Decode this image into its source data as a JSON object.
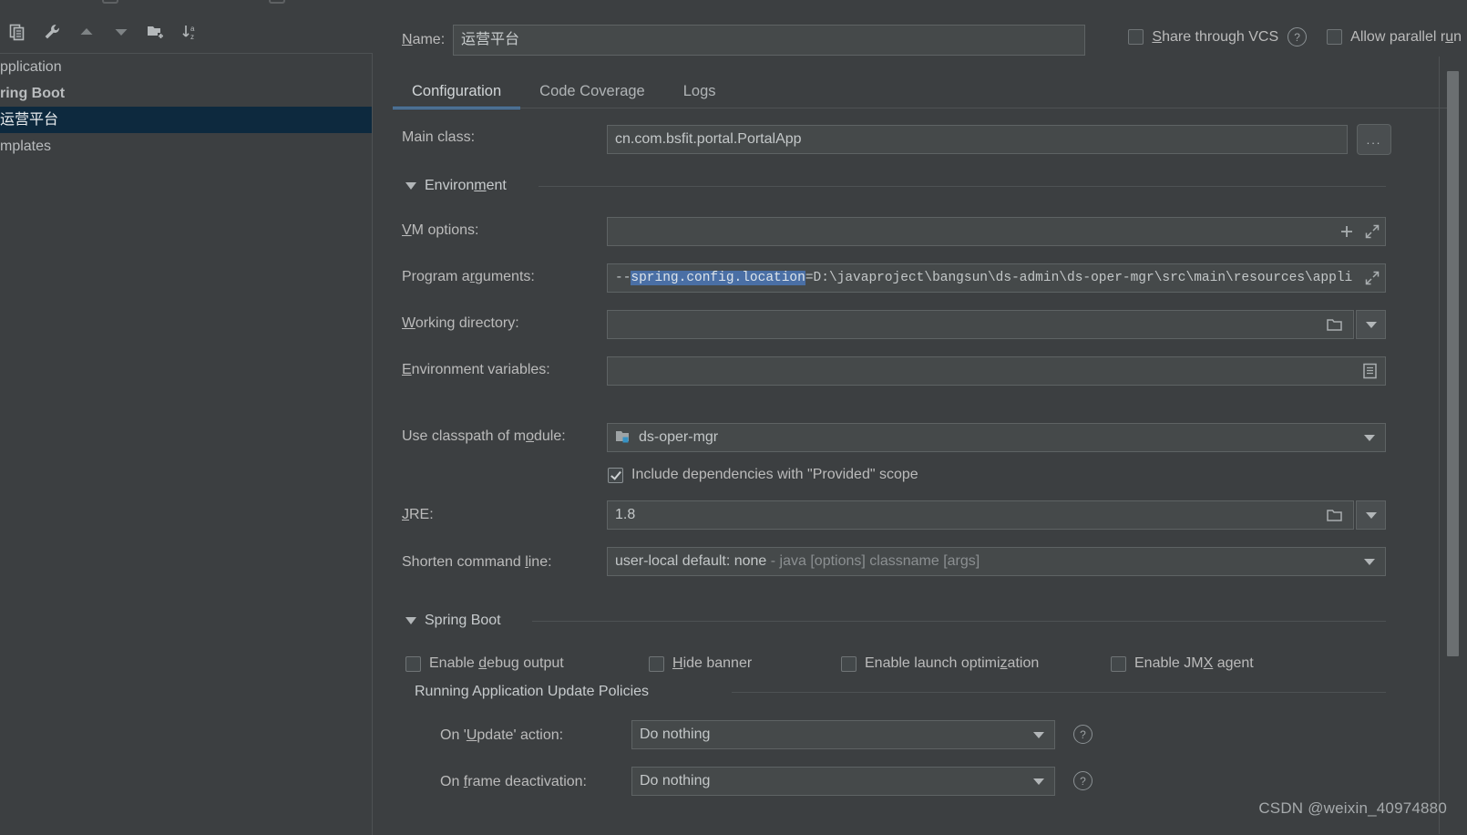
{
  "window": {
    "background_color": "#3c3f41",
    "accent_color": "#4a88c7",
    "selection_color": "#0d293e",
    "text_selection_color": "#4a6fa5"
  },
  "toolbar": {
    "icons": [
      {
        "name": "copy-configuration-icon",
        "title": "Copy Configuration"
      },
      {
        "name": "edit-templates-wrench-icon",
        "title": "Edit Templates"
      },
      {
        "name": "move-up-icon",
        "title": "Move Up"
      },
      {
        "name": "move-down-icon",
        "title": "Move Down"
      },
      {
        "name": "new-folder-icon",
        "title": "Create New Folder"
      },
      {
        "name": "sort-alphabetically-icon",
        "title": "Sort Configurations"
      }
    ]
  },
  "sidebar": {
    "items": [
      {
        "label": "pplication",
        "selected": false
      },
      {
        "label": "ring Boot",
        "selected": false
      },
      {
        "label": "运营平台",
        "selected": true
      },
      {
        "label": "mplates",
        "selected": false
      }
    ]
  },
  "header": {
    "name_label": "Name:",
    "name_label_mnemonic": "N",
    "name_value": "运营平台",
    "share_vcs_label": "Share through VCS",
    "share_vcs_mnemonic": "S",
    "share_vcs_checked": false,
    "help_icon": "help-icon",
    "allow_parallel_label": "Allow parallel run",
    "allow_parallel_mnemonic": "u",
    "allow_parallel_checked": false
  },
  "tabs": [
    {
      "label": "Configuration",
      "active": true
    },
    {
      "label": "Code Coverage",
      "active": false
    },
    {
      "label": "Logs",
      "active": false
    }
  ],
  "form": {
    "main_class": {
      "label": "Main class:",
      "value": "cn.com.bsfit.portal.PortalApp",
      "browse_button": "..."
    },
    "environment_section": {
      "title": "Environment",
      "mnemonic": "m",
      "expanded": true
    },
    "vm_options": {
      "label": "VM options:",
      "mnemonic": "V",
      "value": "",
      "icons": [
        "plus-icon",
        "expand-editor-icon"
      ]
    },
    "program_arguments": {
      "label": "Program arguments:",
      "mnemonic": "r",
      "value_prefix": "--",
      "value_selected": "spring.config.location",
      "value_suffix": "=D:\\javaproject\\bangsun\\ds-admin\\ds-oper-mgr\\src\\main\\resources\\appli",
      "icons": [
        "expand-editor-icon"
      ]
    },
    "working_directory": {
      "label": "Working directory:",
      "mnemonic": "W",
      "value": "",
      "icons": [
        "folder-icon",
        "dropdown-arrow-icon"
      ]
    },
    "environment_variables": {
      "label": "Environment variables:",
      "mnemonic": "E",
      "value": "",
      "icons": [
        "env-list-icon"
      ]
    },
    "classpath_module": {
      "label": "Use classpath of module:",
      "mnemonic": "o",
      "value": "ds-oper-mgr",
      "module_icon": "module-icon"
    },
    "include_provided": {
      "label": "Include dependencies with \"Provided\" scope",
      "checked": true
    },
    "jre": {
      "label": "JRE:",
      "mnemonic": "J",
      "value": "1.8",
      "icons": [
        "folder-icon",
        "dropdown-arrow-icon"
      ]
    },
    "shorten_command_line": {
      "label": "Shorten command line:",
      "mnemonic": "l",
      "value": "user-local default: none",
      "value_hint": "- java [options] classname [args]"
    },
    "spring_boot_section": {
      "title": "Spring Boot",
      "mnemonic": "g",
      "expanded": true
    },
    "spring_boot_checkboxes": [
      {
        "label": "Enable debug output",
        "mnemonic": "d",
        "checked": false
      },
      {
        "label": "Hide banner",
        "mnemonic": "H",
        "checked": false
      },
      {
        "label": "Enable launch optimization",
        "mnemonic": "z",
        "checked": false
      },
      {
        "label": "Enable JMX agent",
        "mnemonic": "X",
        "checked": false
      }
    ],
    "update_policies": {
      "title": "Running Application Update Policies",
      "on_update_label": "On 'Update' action:",
      "on_update_mnemonic": "U",
      "on_update_value": "Do nothing",
      "on_frame_label": "On frame deactivation:",
      "on_frame_mnemonic": "f",
      "on_frame_value": "Do nothing",
      "help_icon": "help-icon"
    }
  },
  "watermark": "CSDN @weixin_40974880"
}
